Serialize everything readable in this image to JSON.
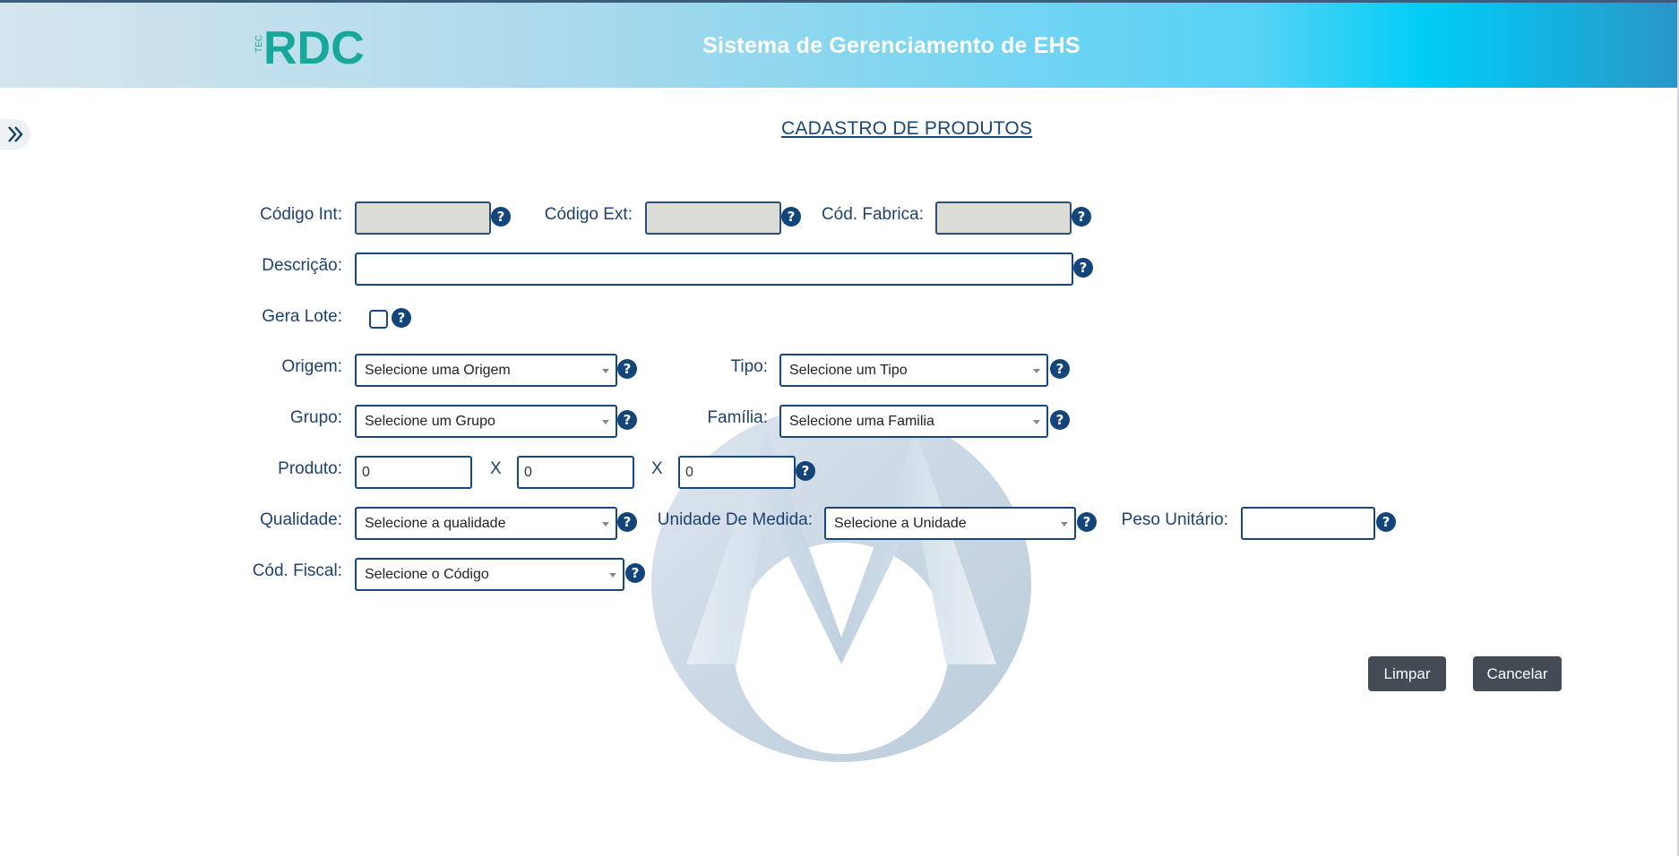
{
  "header": {
    "logo_text": "RDC",
    "logo_small_text": "TEC",
    "title": "Sistema de Gerenciamento de EHS"
  },
  "page": {
    "title": "CADASTRO DE PRODUTOS"
  },
  "form": {
    "codigo_int": {
      "label": "Código Int:",
      "value": ""
    },
    "codigo_ext": {
      "label": "Código Ext:",
      "value": ""
    },
    "cod_fabrica": {
      "label": "Cód. Fabrica:",
      "value": ""
    },
    "descricao": {
      "label": "Descrição:",
      "value": ""
    },
    "gera_lote": {
      "label": "Gera Lote:",
      "checked": false
    },
    "origem": {
      "label": "Origem:",
      "selected": "Selecione uma Origem"
    },
    "tipo": {
      "label": "Tipo:",
      "selected": "Selecione um Tipo"
    },
    "grupo": {
      "label": "Grupo:",
      "selected": "Selecione um Grupo"
    },
    "familia": {
      "label": "Família:",
      "selected": "Selecione uma Familia"
    },
    "produto": {
      "label": "Produto:",
      "dim1": "0",
      "dim2": "0",
      "dim3": "0",
      "separator": "X"
    },
    "qualidade": {
      "label": "Qualidade:",
      "selected": "Selecione a qualidade"
    },
    "unidade": {
      "label": "Unidade De Medida:",
      "selected": "Selecione a Unidade"
    },
    "peso_unitario": {
      "label": "Peso Unitário:",
      "value": ""
    },
    "cod_fiscal": {
      "label": "Cód. Fiscal:",
      "selected": "Selecione o Código"
    },
    "help_glyph": "?"
  },
  "actions": {
    "limpar": "Limpar",
    "cancelar": "Cancelar"
  },
  "icons": {
    "sidebar_toggle": "double-chevron-right-icon",
    "help": "question-circle-icon"
  },
  "colors": {
    "brand_teal": "#17a89a",
    "label": "#1e416d",
    "field_border": "#17477b",
    "button": "#444b55"
  }
}
